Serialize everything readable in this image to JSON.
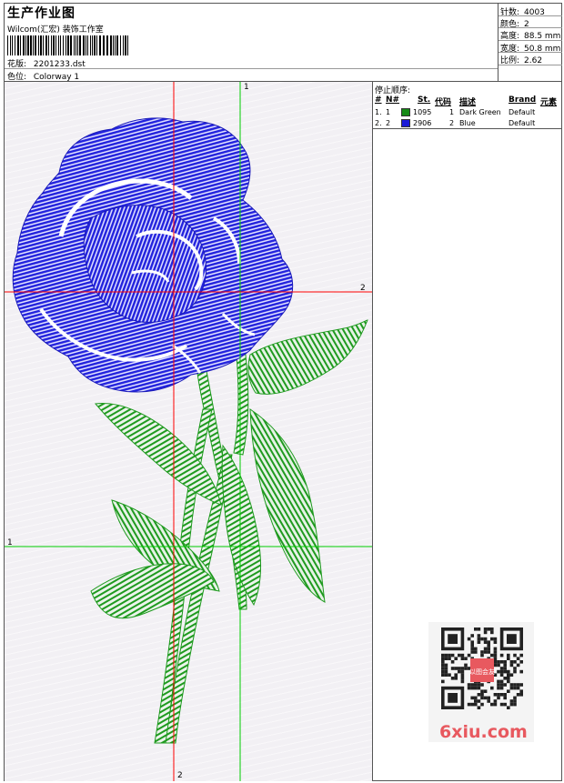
{
  "header": {
    "title": "生产作业图",
    "company": "Wilcom(汇宏) 装饰工作室",
    "design_label": "花版:",
    "design_value": "2201233.dst",
    "colorway_label": "色位:",
    "colorway_value": "Colorway 1"
  },
  "stats": {
    "stitches_label": "针数:",
    "stitches_value": "4003",
    "colors_label": "颜色:",
    "colors_value": "2",
    "height_label": "高度:",
    "height_value": "88.5 mm",
    "width_label": "宽度:",
    "width_value": "50.8 mm",
    "scale_label": "比例:",
    "scale_value": "2.62"
  },
  "color_table": {
    "title": "停止顺序:",
    "headers": {
      "num": "#",
      "n": "N#",
      "st": "St.",
      "code": "代码",
      "desc": "描述",
      "brand": "Brand",
      "element": "元素"
    },
    "rows": [
      {
        "num": "1.",
        "n": "1",
        "color": "#168a16",
        "st": "1095",
        "code": "1",
        "desc": "Dark Green",
        "brand": "Default"
      },
      {
        "num": "2.",
        "n": "2",
        "color": "#1a1ad8",
        "st": "2906",
        "code": "2",
        "desc": "Blue",
        "brand": "Default"
      }
    ]
  },
  "guides": {
    "green_v": "1",
    "green_h": "1",
    "red_h": "2",
    "red_v": "2"
  },
  "colors": {
    "thread_blue": "#2222dd",
    "thread_green": "#1f9a1f",
    "guide_red": "#ff0000",
    "guide_green": "#00cc00",
    "watermark": "#e8595f"
  },
  "watermark": {
    "text": "6xiu.com",
    "badge": "以图会友"
  }
}
